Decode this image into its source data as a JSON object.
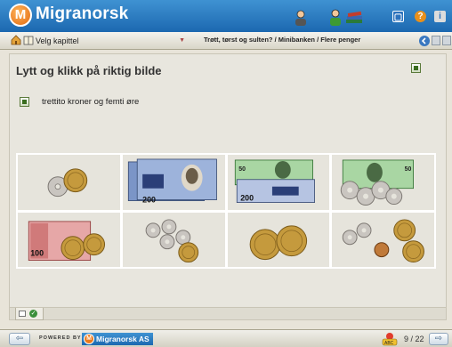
{
  "app": {
    "logo_letter": "M",
    "title": "Migranorsk"
  },
  "top_icons": [
    "person-icon",
    "user-green-icon",
    "books-icon",
    "fullscreen-icon",
    "help-icon",
    "info-icon"
  ],
  "chapter": {
    "label": "Velg kapittel"
  },
  "breadcrumb": "Trøtt, tørst og sulten? / Minibanken / Flere penger",
  "exercise": {
    "title": "Lytt og klikk på riktig bilde",
    "prompt": "trettito kroner og femti øre"
  },
  "choices": [
    {
      "name": "choice-coins-1",
      "content": "coins"
    },
    {
      "name": "choice-200-banknotes",
      "content": "banknotes-200"
    },
    {
      "name": "choice-200-50-banknotes",
      "content": "banknotes-200-50"
    },
    {
      "name": "choice-50-banknote-coins",
      "content": "banknote-50-coins"
    },
    {
      "name": "choice-100-banknote-coins",
      "content": "banknote-100-coins"
    },
    {
      "name": "choice-coins-2",
      "content": "coins"
    },
    {
      "name": "choice-coins-3",
      "content": "coins"
    },
    {
      "name": "choice-coins-4",
      "content": "coins"
    }
  ],
  "banknotes": {
    "note_200": "200",
    "note_50": "50",
    "note_100": "100"
  },
  "footer": {
    "powered_by": "POWERED BY",
    "brand": "Migranorsk AS",
    "page_counter": "9 / 22"
  },
  "colors": {
    "header_blue": "#1c68b0",
    "brand_orange": "#e26a10",
    "note_200_blue": "#5c7fb8",
    "note_50_green": "#5ea05a",
    "note_100_red": "#c85050"
  }
}
